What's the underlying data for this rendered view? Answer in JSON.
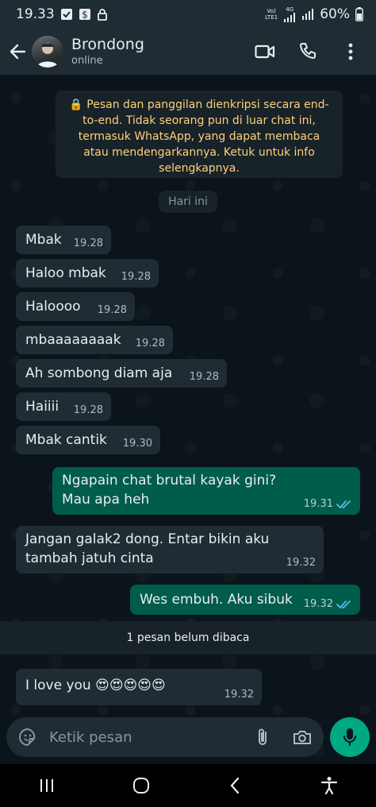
{
  "status_bar": {
    "time": "19.33",
    "network_top": "Vo)",
    "network_bottom": "LTE1",
    "network_gen": "4G",
    "battery": "60%"
  },
  "header": {
    "contact_name": "Brondong",
    "contact_status": "online"
  },
  "encryption_notice": "🔒 Pesan dan panggilan dienkripsi secara end-to-end. Tidak seorang pun di luar chat ini, termasuk WhatsApp, yang dapat membaca atau mendengarkannya. Ketuk untuk info selengkapnya.",
  "date_chip": "Hari ini",
  "messages": [
    {
      "direction": "in",
      "text": "Mbak",
      "time": "19.28"
    },
    {
      "direction": "in",
      "text": "Haloo mbak",
      "time": "19.28"
    },
    {
      "direction": "in",
      "text": "Haloooo",
      "time": "19.28"
    },
    {
      "direction": "in",
      "text": "mbaaaaaaaak",
      "time": "19.28"
    },
    {
      "direction": "in",
      "text": "Ah sombong diam aja",
      "time": "19.28"
    },
    {
      "direction": "in",
      "text": "Haiiii",
      "time": "19.28"
    },
    {
      "direction": "in",
      "text": "Mbak cantik",
      "time": "19.30"
    },
    {
      "direction": "out",
      "text": "Ngapain chat brutal kayak gini? Mau apa heh",
      "time": "19.31",
      "status": "read"
    },
    {
      "direction": "in",
      "text": "Jangan galak2 dong. Entar bikin aku tambah jatuh cinta",
      "time": "19.32"
    },
    {
      "direction": "out",
      "text": "Wes embuh. Aku sibuk",
      "time": "19.32",
      "status": "read"
    },
    {
      "direction": "in",
      "text": "I love you 😍😍😍😍😍",
      "time": "19.32"
    }
  ],
  "unread_banner": "1 pesan belum dibaca",
  "composer": {
    "placeholder": "Ketik pesan"
  },
  "colors": {
    "background": "#0b141a",
    "incoming_bubble": "#202c33",
    "outgoing_bubble": "#005c4b",
    "accent": "#00a884",
    "read_ticks": "#53bdeb"
  },
  "icons": [
    "back-arrow-icon",
    "video-call-icon",
    "phone-icon",
    "menu-dots-icon",
    "sticker-icon",
    "attach-icon",
    "camera-icon",
    "mic-icon",
    "lock-icon",
    "double-check-icon"
  ]
}
